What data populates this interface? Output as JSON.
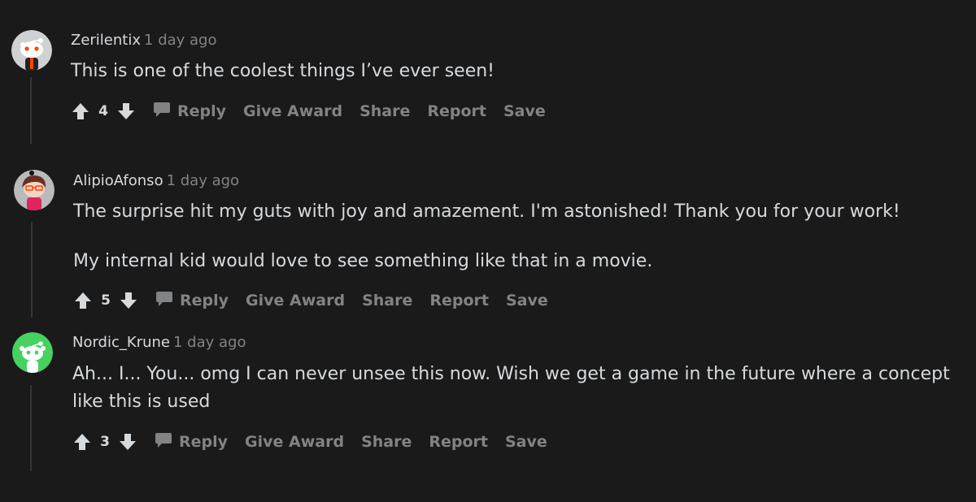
{
  "comments": [
    {
      "author": "Zerilentix",
      "time": "1 day ago",
      "paragraphs": [
        "This is one of the coolest things I’ve ever seen!"
      ],
      "score": "4",
      "avatar_icon": "snoo-avatar-icon",
      "avatar_bg": "#cfd1d3"
    },
    {
      "author": "AlipioAfonso",
      "time": "1 day ago",
      "paragraphs": [
        "The surprise hit my guts with joy and amazement. I'm astonished! Thank you for your work!",
        "My internal kid would love to see something like that in a movie."
      ],
      "score": "5",
      "avatar_icon": "snoo-avatar-icon",
      "avatar_bg": "#b8babc"
    },
    {
      "author": "Nordic_Krune",
      "time": "1 day ago",
      "paragraphs": [
        "Ah... I... You... omg I can never unsee this now. Wish we get a game in the future where a concept like this is used"
      ],
      "score": "3",
      "avatar_icon": "snoo-avatar-icon",
      "avatar_bg": "#46d160"
    }
  ],
  "actions": {
    "reply": "Reply",
    "give_award": "Give Award",
    "share": "Share",
    "report": "Report",
    "save": "Save"
  },
  "colors": {
    "background": "#1a1a1b",
    "text": "#d7dadc",
    "muted": "#818384",
    "thread_line": "#343536"
  }
}
